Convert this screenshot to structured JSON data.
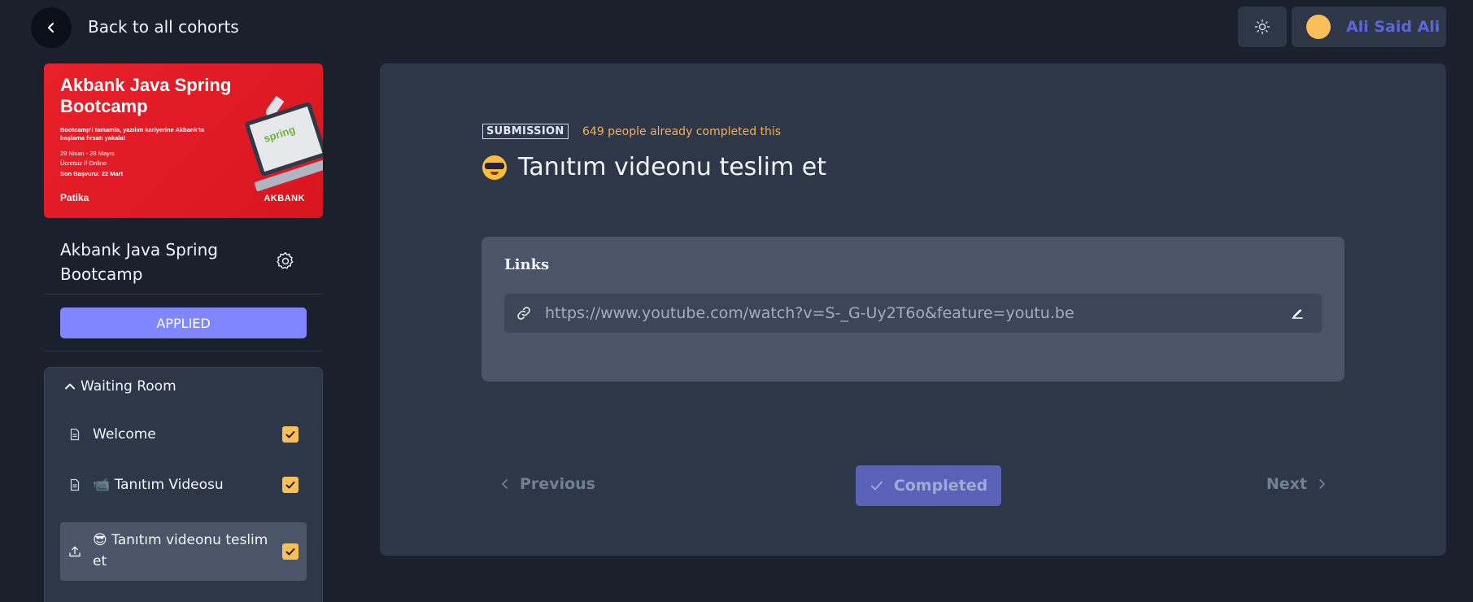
{
  "header": {
    "back_label": "Back to all cohorts",
    "user_name": "Ali Said Ali"
  },
  "banner": {
    "title": "Akbank Java Spring Bootcamp",
    "subtitle": "Bootcamp'i tamamla, yazılım kariyerine Akbank'ta başlama fırsatı yakala!",
    "dates": "29 Nisan - 28 Mayıs",
    "format": "Ücretsiz // Online",
    "deadline": "Son Başvuru: 22 Mart",
    "logo_text": "Patika",
    "laptop_logo_text": "spring",
    "bank_text": "AKBANK"
  },
  "sidebar": {
    "course_name": "Akbank Java Spring Bootcamp",
    "status_label": "APPLIED",
    "section_title": "Waiting Room",
    "lessons": [
      {
        "label": "Welcome",
        "icon": "document-icon",
        "completed": true
      },
      {
        "label": "📹 Tanıtım Videosu",
        "icon": "document-icon",
        "completed": true
      },
      {
        "label": "😎 Tanıtım videonu teslim et",
        "icon": "upload-icon",
        "completed": true
      }
    ]
  },
  "main": {
    "tag": "SUBMISSION",
    "completed_count_text": "649 people already completed this",
    "title": "Tanıtım videonu teslim et",
    "links_title": "Links",
    "link_value": "https://www.youtube.com/watch?v=S-_G-Uy2T6o&feature=youtu.be",
    "prev_label": "Previous",
    "complete_label": "Completed",
    "next_label": "Next"
  },
  "colors": {
    "background": "#1a202c",
    "card": "#2d3748",
    "accent": "#7f86ff",
    "checkbox": "#fbbf5a",
    "count_text": "#f6ad55",
    "banner": "#e8202a"
  }
}
